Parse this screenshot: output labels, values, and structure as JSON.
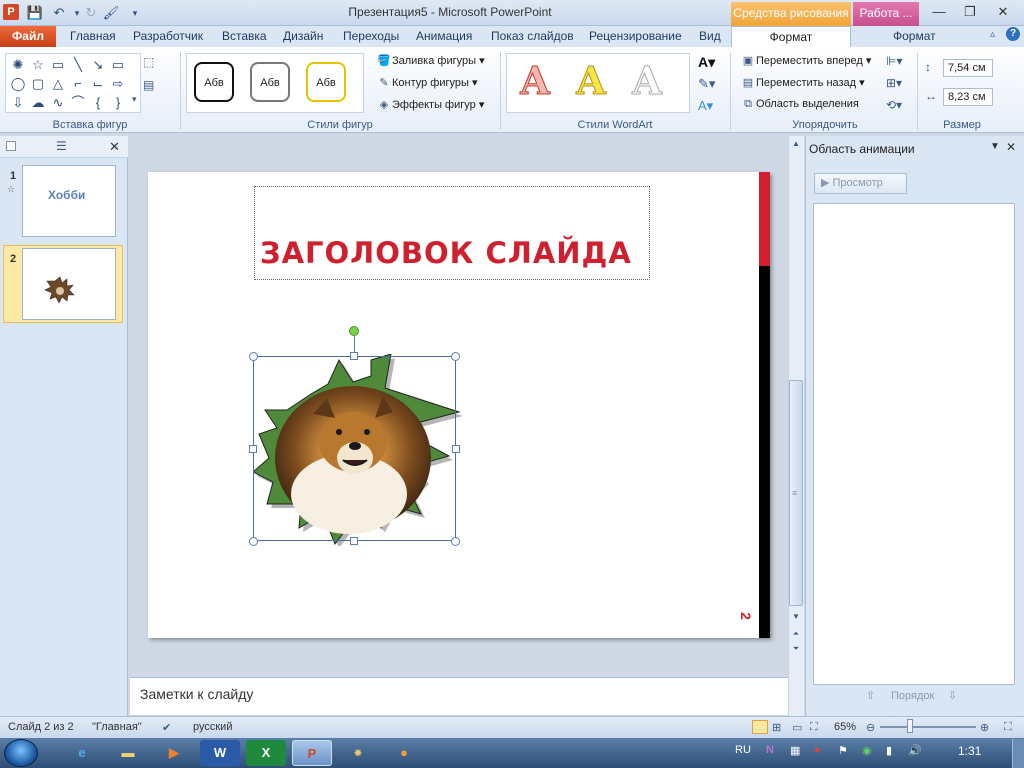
{
  "window": {
    "title": "Презентация5  -  Microsoft PowerPoint",
    "context_drawing": "Средства рисования",
    "context_pictures": "Работа ...",
    "minimize": "—",
    "maximize": "❐",
    "close": "✕"
  },
  "tabs": {
    "file": "Файл",
    "home": "Главная",
    "developer": "Разработчик",
    "insert": "Вставка",
    "design": "Дизайн",
    "transitions": "Переходы",
    "animation": "Анимация",
    "slideshow": "Показ слайдов",
    "review": "Рецензирование",
    "view": "Вид",
    "format_drawing": "Формат",
    "format_pictures": "Формат"
  },
  "ribbon": {
    "insert_shapes_label": "Вставка фигур",
    "shape_styles_label": "Стили фигур",
    "wordart_label": "Стили WordArt",
    "arrange_label": "Упорядочить",
    "size_label": "Размер",
    "style_sample": "Абв",
    "shape_fill": "Заливка фигуры",
    "shape_outline": "Контур фигуры",
    "shape_effects": "Эффекты фигур",
    "bring_forward": "Переместить вперед",
    "send_backward": "Переместить назад",
    "selection_pane": "Область выделения",
    "height": "7,54 см",
    "width": "8,23 см",
    "wordart_letter": "A"
  },
  "slides_panel": {
    "slide1_num": "1",
    "slide1_title": "Хобби",
    "slide2_num": "2"
  },
  "slide": {
    "title": "ЗАГОЛОВОК СЛАЙДА",
    "number": "2"
  },
  "notes": {
    "placeholder": "Заметки к слайду"
  },
  "animation_pane": {
    "title": "Область анимации",
    "preview": "Просмотр",
    "order": "Порядок"
  },
  "statusbar": {
    "slide_info": "Слайд 2 из 2",
    "theme": "\"Главная\"",
    "language": "русский",
    "zoom": "65%"
  },
  "taskbar": {
    "language": "RU",
    "time": "1:31"
  },
  "colors": {
    "title_red": "#d0202e",
    "accent_orange": "#f1a437",
    "accent_pink": "#c74f8f"
  }
}
